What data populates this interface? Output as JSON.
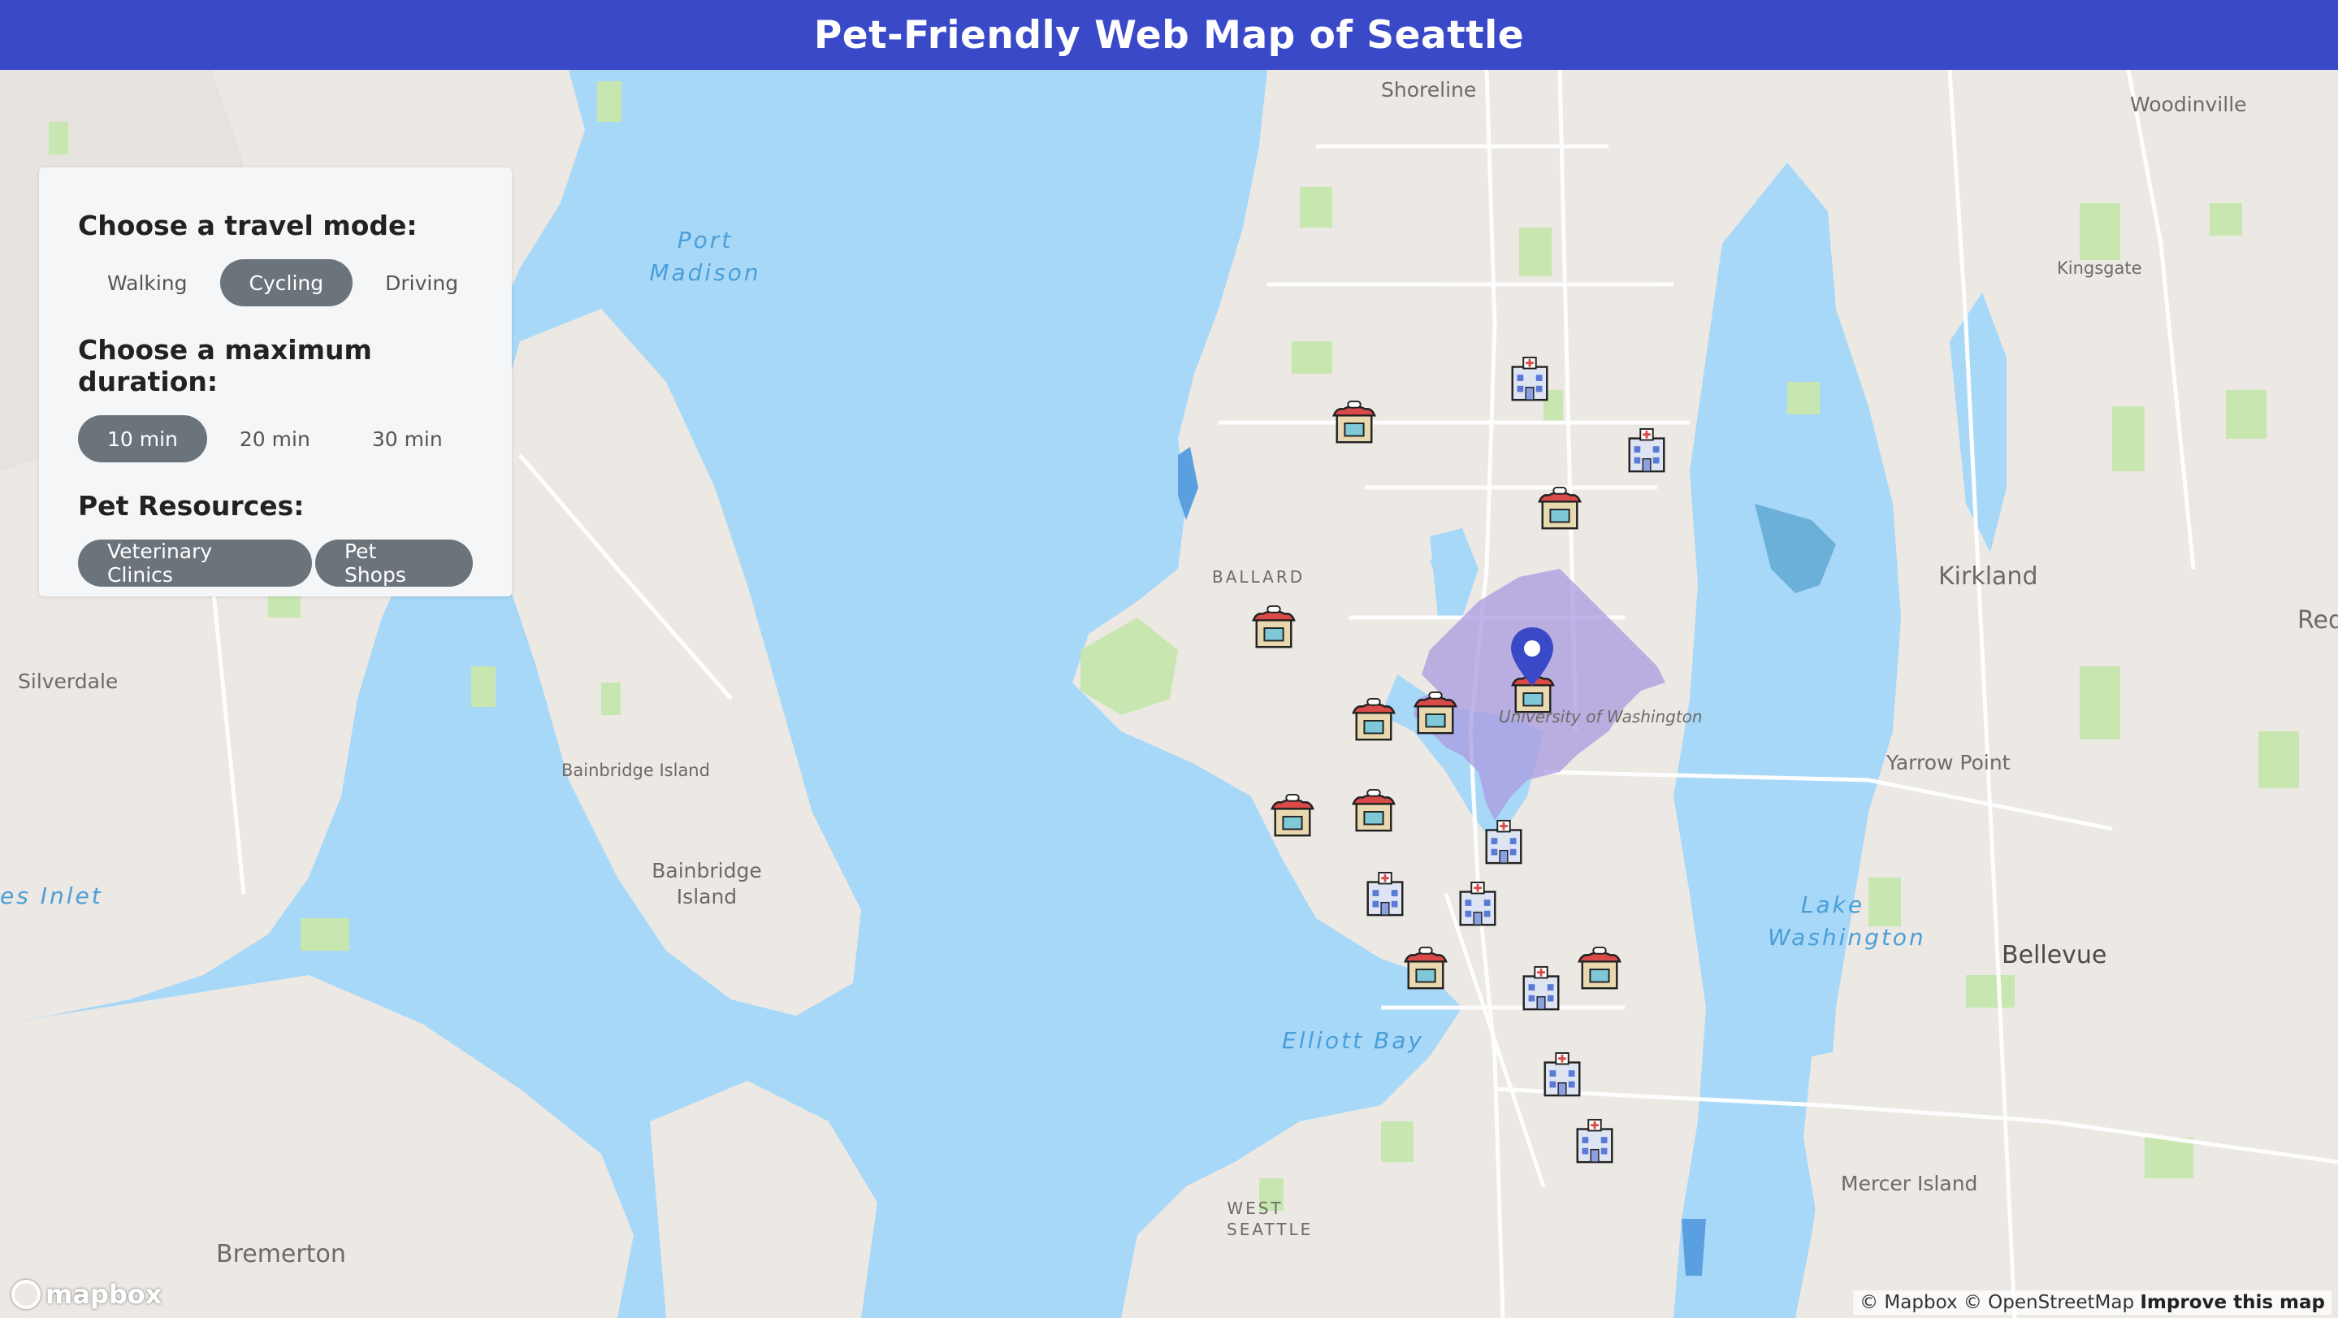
{
  "title": "Pet-Friendly Web Map of Seattle",
  "panel": {
    "travel_mode_heading": "Choose a travel mode:",
    "travel_modes": [
      {
        "label": "Walking",
        "active": false
      },
      {
        "label": "Cycling",
        "active": true
      },
      {
        "label": "Driving",
        "active": false
      }
    ],
    "duration_heading": "Choose a maximum duration:",
    "durations": [
      {
        "label": "10 min",
        "active": true
      },
      {
        "label": "20 min",
        "active": false
      },
      {
        "label": "30 min",
        "active": false
      }
    ],
    "resources_heading": "Pet Resources:",
    "resources": [
      {
        "label": "Veterinary Clinics",
        "active": true
      },
      {
        "label": "Pet Shops",
        "active": true
      }
    ]
  },
  "map_labels": {
    "shoreline": "Shoreline",
    "woodinville": "Woodinville",
    "kingsgate": "Kingsgate",
    "kirkland": "Kirkland",
    "redmond": "Redm",
    "ballard": "BALLARD",
    "university": "University of Washington",
    "silverdale": "Silverdale",
    "bainbridge_island_small": "Bainbridge Island",
    "bainbridge_island_large": "Bainbridge Island",
    "yarrow_point": "Yarrow Point",
    "bellevue": "Bellevue",
    "mercer_island": "Mercer Island",
    "west_seattle": "WEST SEATTLE",
    "bremerton": "Bremerton"
  },
  "water_labels": {
    "port_madison": "Port Madison",
    "dyes_inlet": "es Inlet",
    "elliott_bay": "Elliott Bay",
    "lake_washington": "Lake Washington"
  },
  "attribution": {
    "mapbox": "© Mapbox",
    "osm": "© OpenStreetMap",
    "improve": "Improve this map"
  },
  "logo": "mapbox",
  "colors": {
    "header": "#3a49c8",
    "water": "#a8d8f8",
    "land": "#ece8e4",
    "park": "#c8e6b0",
    "isochrone": "#a99be0",
    "location_pin": "#3a49c8",
    "active_pill": "#6b737b"
  },
  "markers": {
    "location": "location-pin-icon",
    "vet": "veterinary-clinic-icon",
    "shop": "pet-shop-icon"
  }
}
